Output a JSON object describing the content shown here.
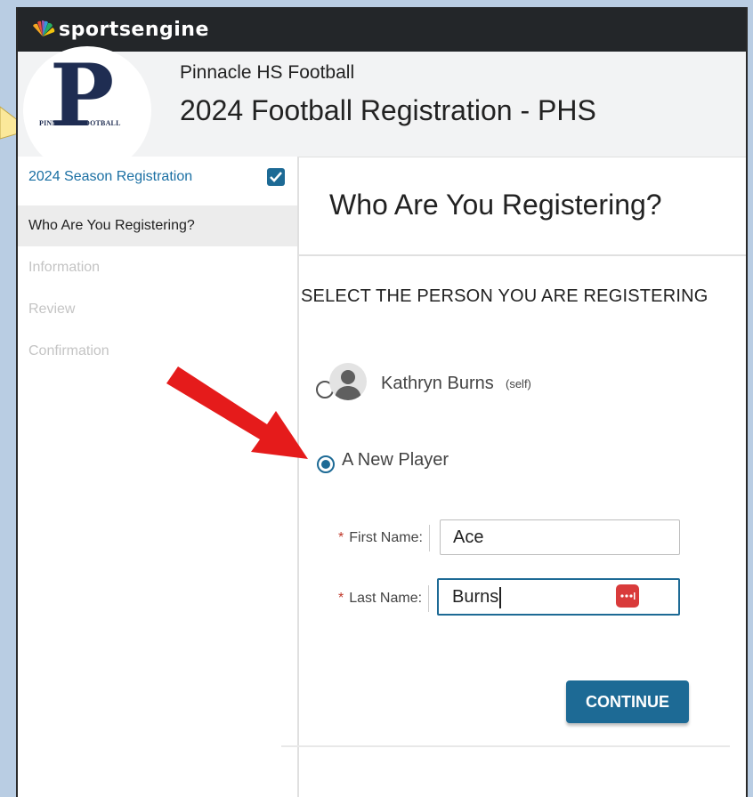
{
  "brand": {
    "name": "sportsengine"
  },
  "org": {
    "name": "Pinnacle HS Football",
    "program_title": "2024 Football Registration - PHS",
    "logo_letter": "P",
    "logo_text": "PINNACLE FOOTBALL"
  },
  "sidebar": {
    "items": [
      {
        "label": "2024 Season Registration",
        "state": "completed"
      },
      {
        "label": "Who Are You Registering?",
        "state": "active"
      },
      {
        "label": "Information",
        "state": "disabled"
      },
      {
        "label": "Review",
        "state": "disabled"
      },
      {
        "label": "Confirmation",
        "state": "disabled"
      }
    ]
  },
  "main": {
    "title": "Who Are You Registering?",
    "section_label": "SELECT THE PERSON YOU ARE REGISTERING",
    "options": [
      {
        "name": "Kathryn Burns",
        "tag": "(self)",
        "selected": false
      },
      {
        "name": "A New Player",
        "selected": true
      }
    ],
    "form": {
      "first_name": {
        "label": "First Name:",
        "value": "Ace"
      },
      "last_name": {
        "label": "Last Name:",
        "value": "Burns"
      }
    },
    "continue_label": "CONTINUE"
  },
  "colors": {
    "accent": "#1d6a95",
    "topbar": "#232629",
    "arrow": "#e51b1b",
    "required": "#c0392b"
  }
}
